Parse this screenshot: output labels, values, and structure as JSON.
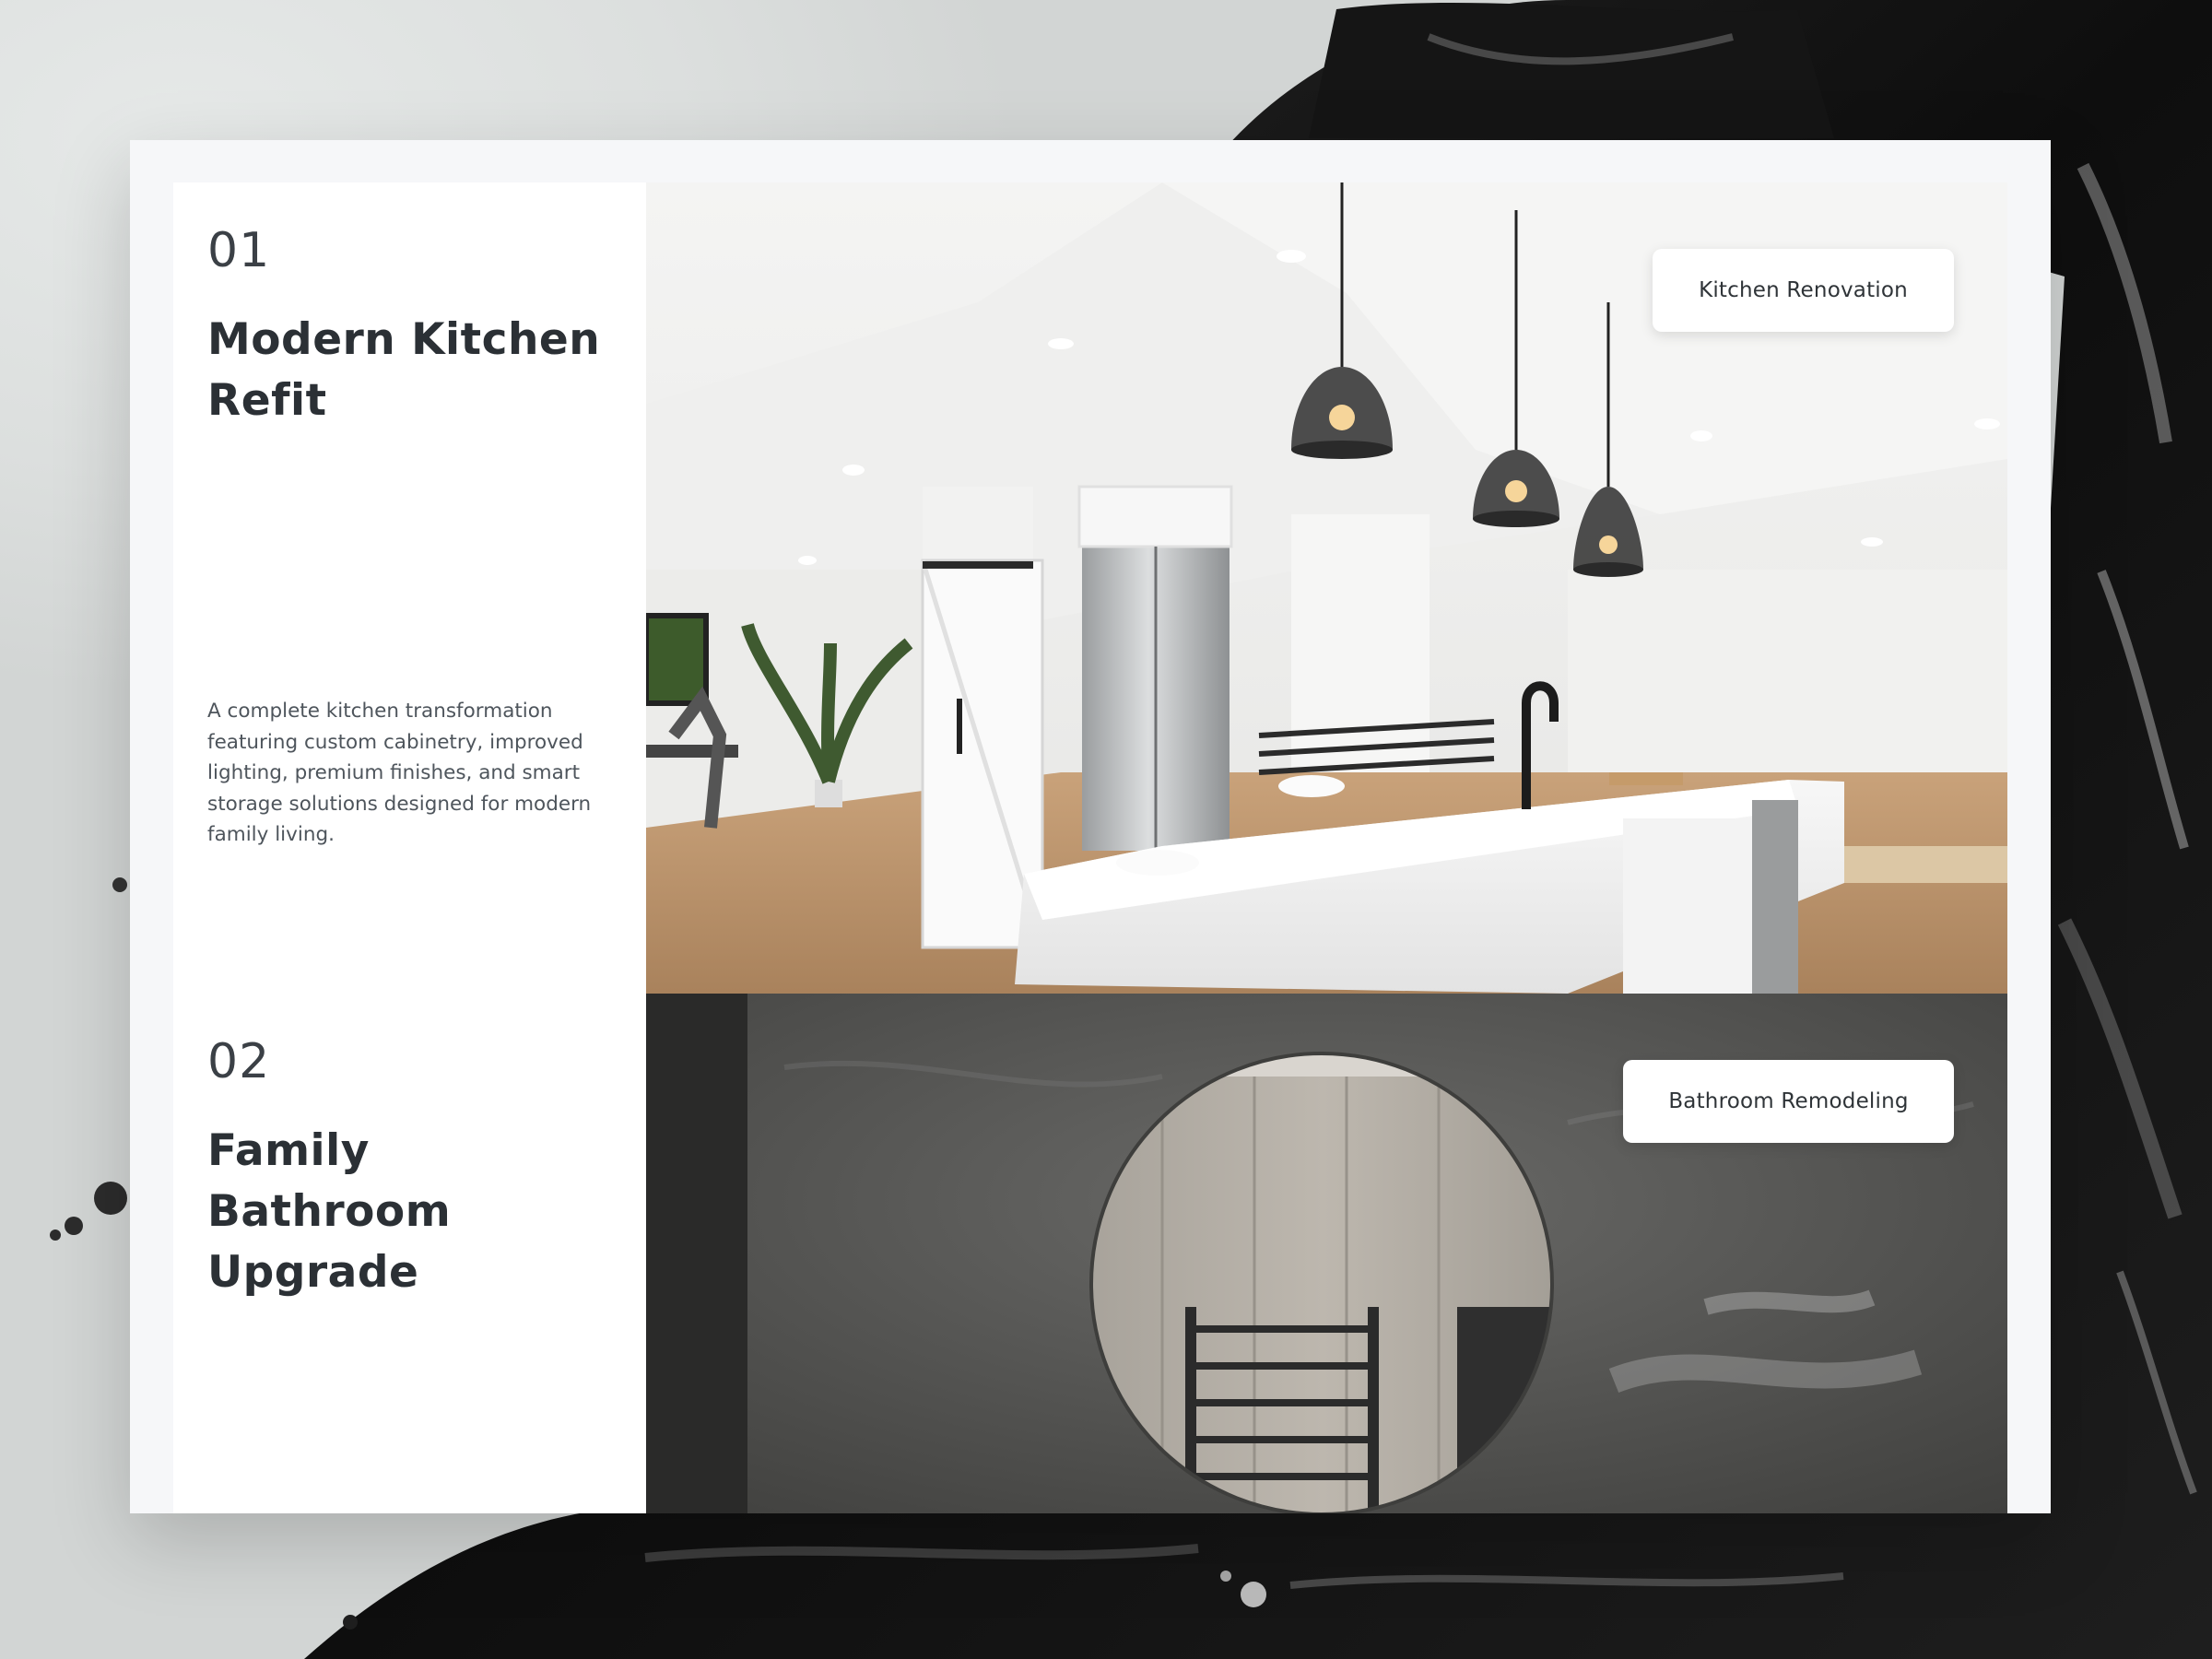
{
  "projects": [
    {
      "number": "01",
      "title_line1": "Modern Kitchen",
      "title_line2": "Refit",
      "description": "A complete kitchen transformation featuring custom cabinetry, improved lighting, premium finishes, and smart storage solutions designed for modern family living.",
      "tag": "Kitchen Renovation",
      "image": "kitchen-photo"
    },
    {
      "number": "02",
      "title_line1": "Family Bathroom",
      "title_line2": "Upgrade",
      "tag": "Bathroom Remodeling",
      "image": "bathroom-photo"
    }
  ],
  "colors": {
    "card_background": "#f6f7f9",
    "panel_background": "#ffffff",
    "heading_text": "#2b3035",
    "body_text": "#4e555c"
  }
}
